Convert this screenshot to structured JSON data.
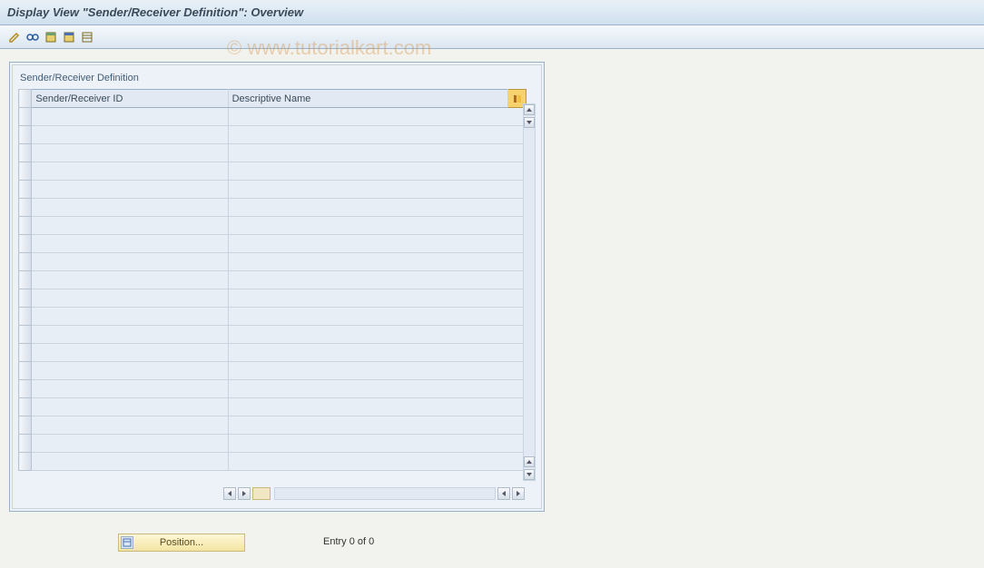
{
  "title": "Display View \"Sender/Receiver Definition\": Overview",
  "toolbar": {
    "icons": [
      "edit-icon",
      "glasses-icon",
      "selectall-icon",
      "selectblock-icon",
      "deselect-icon"
    ]
  },
  "panel": {
    "title": "Sender/Receiver Definition",
    "columns": {
      "id": "Sender/Receiver ID",
      "name": "Descriptive Name"
    },
    "rows": [
      {
        "id": "",
        "name": ""
      },
      {
        "id": "",
        "name": ""
      },
      {
        "id": "",
        "name": ""
      },
      {
        "id": "",
        "name": ""
      },
      {
        "id": "",
        "name": ""
      },
      {
        "id": "",
        "name": ""
      },
      {
        "id": "",
        "name": ""
      },
      {
        "id": "",
        "name": ""
      },
      {
        "id": "",
        "name": ""
      },
      {
        "id": "",
        "name": ""
      },
      {
        "id": "",
        "name": ""
      },
      {
        "id": "",
        "name": ""
      },
      {
        "id": "",
        "name": ""
      },
      {
        "id": "",
        "name": ""
      },
      {
        "id": "",
        "name": ""
      },
      {
        "id": "",
        "name": ""
      },
      {
        "id": "",
        "name": ""
      },
      {
        "id": "",
        "name": ""
      },
      {
        "id": "",
        "name": ""
      },
      {
        "id": "",
        "name": ""
      }
    ]
  },
  "footer": {
    "position_label": "Position...",
    "entry_text": "Entry 0 of 0"
  },
  "watermark": "© www.tutorialkart.com"
}
